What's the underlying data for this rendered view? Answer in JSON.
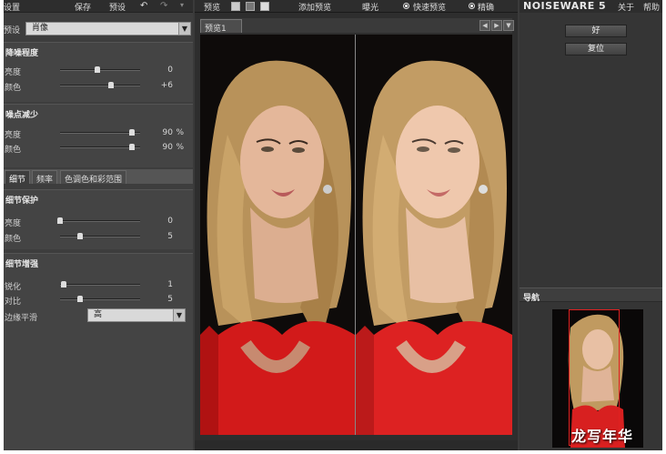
{
  "topbar": {
    "title": "设置",
    "save": "保存",
    "presets": "预设"
  },
  "preset": {
    "label": "预设",
    "value": "肖像"
  },
  "noise_level": {
    "title": "降噪程度",
    "rows": [
      {
        "label": "亮度",
        "value": "0",
        "level": 0.47
      },
      {
        "label": "颜色",
        "value": "+6",
        "level": 0.64
      }
    ]
  },
  "noise_reduction": {
    "title": "噪点减少",
    "rows": [
      {
        "label": "亮度",
        "value": "90",
        "unit": "%",
        "level": 0.9
      },
      {
        "label": "颜色",
        "value": "90",
        "unit": "%",
        "level": 0.9
      }
    ]
  },
  "tabs": [
    "细节",
    "频率",
    "色调色和彩范围"
  ],
  "detail_protect": {
    "title": "细节保护",
    "rows": [
      {
        "label": "亮度",
        "value": "0",
        "level": 0.0
      },
      {
        "label": "颜色",
        "value": "5",
        "level": 0.25
      }
    ]
  },
  "detail_enhance": {
    "title": "细节增强",
    "rows": [
      {
        "label": "锐化",
        "value": "1",
        "level": 0.05
      },
      {
        "label": "对比",
        "value": "5",
        "level": 0.25
      }
    ],
    "edge_label": "边缘平滑",
    "edge_value": "高"
  },
  "center": {
    "preview_menu": "预览",
    "add_preview": "添加预览",
    "exposure": "曝光",
    "fast_preview": "快速预览",
    "accurate": "精确",
    "tab": "预览1"
  },
  "right": {
    "brand": "NOISEWARE 5",
    "about": "关于",
    "help": "帮助",
    "ok": "好",
    "reset": "复位",
    "navigator": "导航"
  },
  "watermark": "龙写年华"
}
